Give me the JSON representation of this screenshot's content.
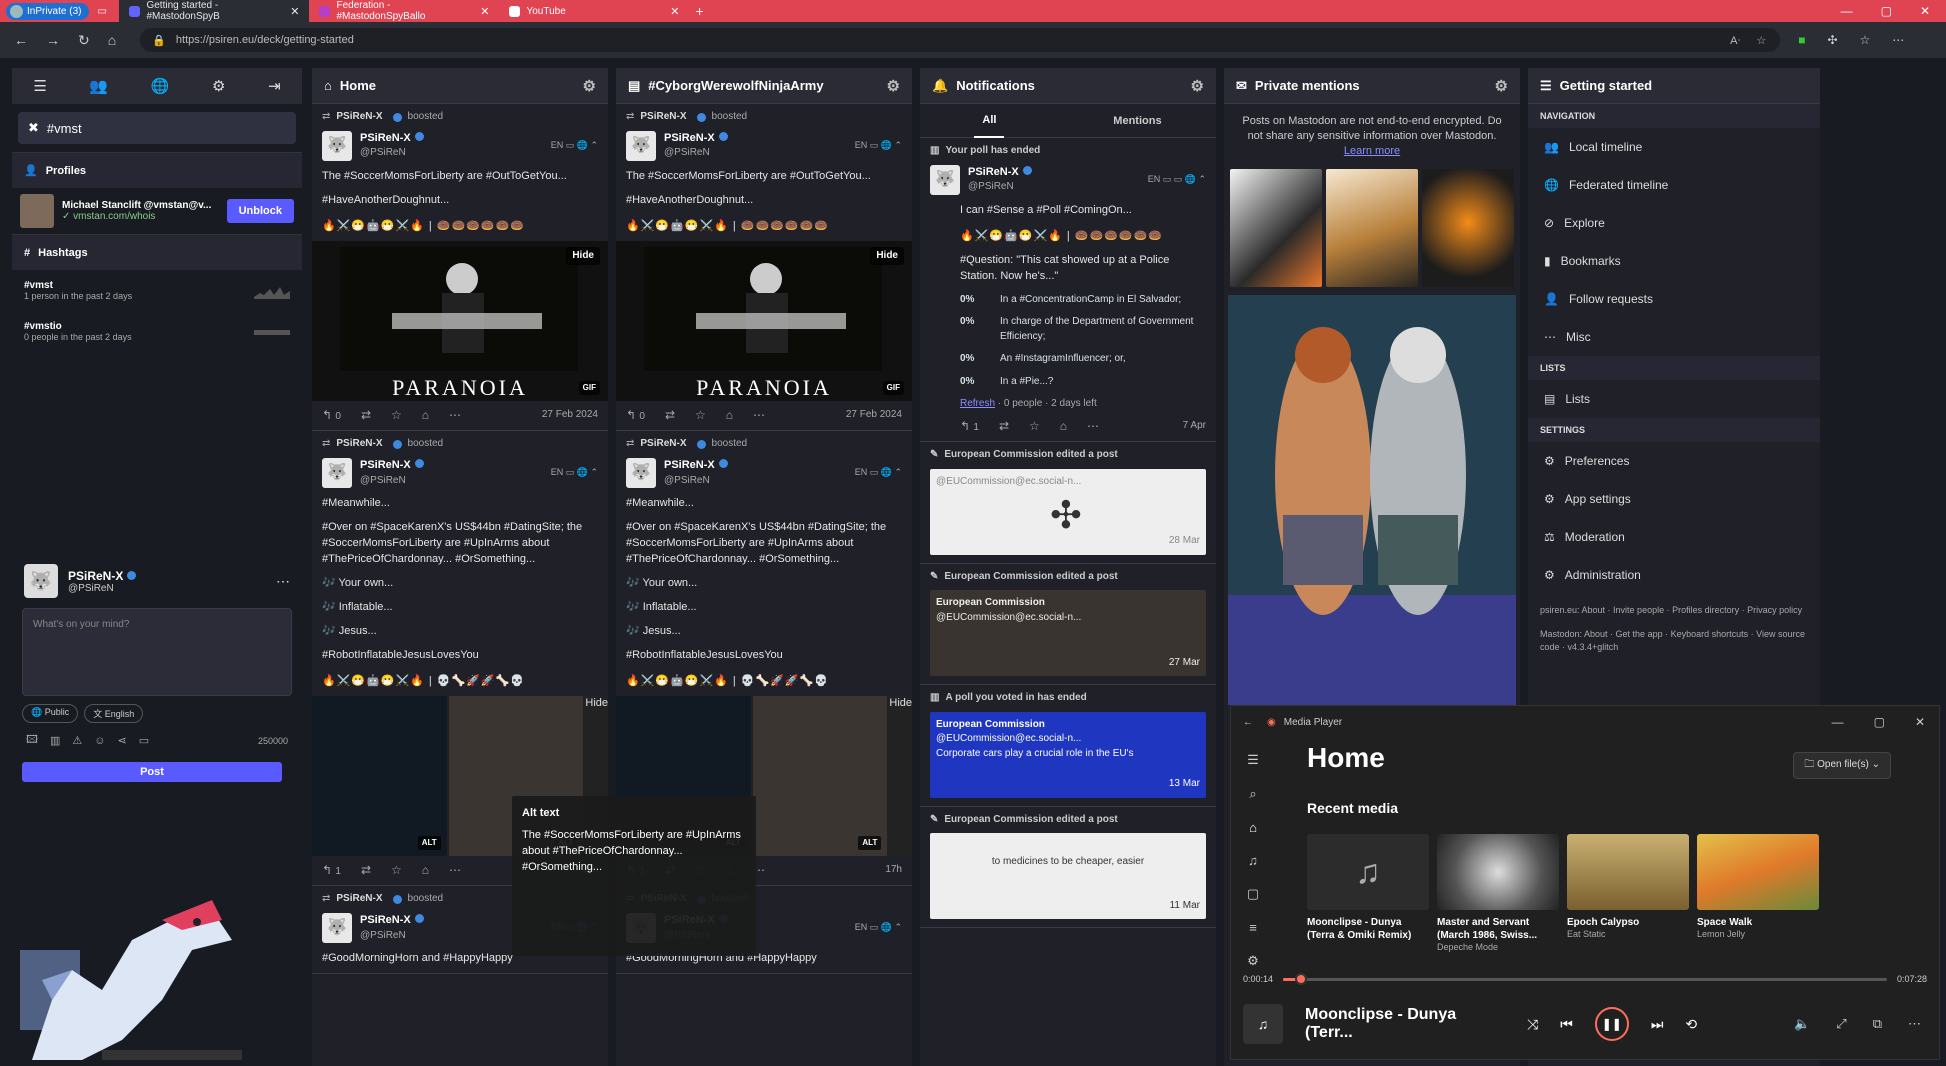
{
  "browser": {
    "private_label": "InPrivate (3)",
    "tabs": [
      {
        "title": "Getting started - #MastodonSpyB",
        "active": true
      },
      {
        "title": "Federation - #MastodonSpyBallo"
      },
      {
        "title": "YouTube"
      }
    ],
    "url": "https://psiren.eu/deck/getting-started"
  },
  "nav_icons": [
    "menu-icon",
    "people-icon",
    "globe-icon",
    "settings-icon",
    "logout-icon"
  ],
  "search": {
    "query": "#vmst"
  },
  "profiles": {
    "header": "Profiles",
    "user_name": "Michael Stanclift @vmstan@v...",
    "user_url": "vmstan.com/whois",
    "unblock": "Unblock"
  },
  "hashtags": {
    "header": "Hashtags",
    "items": [
      {
        "tag": "#vmst",
        "stat": "1 person in the past 2 days"
      },
      {
        "tag": "#vmstio",
        "stat": "0 people in the past 2 days"
      }
    ]
  },
  "me": {
    "name": "PSiReN-X",
    "handle": "@PSiReN"
  },
  "compose": {
    "placeholder": "What's on your mind?",
    "visibility": "Public",
    "language": "English",
    "counter": "250000",
    "post": "Post"
  },
  "columns": {
    "home": "Home",
    "tag": "#CyborgWerewolfNinjaArmy",
    "notifications": "Notifications",
    "private": "Private mentions",
    "getting_started": "Getting started"
  },
  "post": {
    "boosted": "boosted",
    "name": "PSiReN-X",
    "handle": "@PSiReN",
    "lang": "EN",
    "p1_text": "The #SoccerMomsForLiberty are #OutToGetYou...",
    "p1_tag2": "#HaveAnotherDoughnut...",
    "p1_emoji": "🔥⚔️😷🤖😷⚔️🔥 | 🍩🍩🍩🍩🍩🍩",
    "hide": "Hide",
    "gif": "GIF",
    "paranoia": "PARANOIA",
    "p1_replies": "0",
    "p1_time": "27 Feb 2024",
    "p2_l1": "#Meanwhile...",
    "p2_l2": "#Over on #SpaceKarenX's US$44bn #DatingSite; the #SoccerMomsForLiberty are #UpInArms about #ThePriceOfChardonnay... #OrSomething...",
    "p2_l3": "🎶 Your own...",
    "p2_l4": "🎶 Inflatable...",
    "p2_l5": "🎶 Jesus...",
    "p2_l6": "#RobotInflatableJesusLovesYou",
    "p2_emoji": "🔥⚔️😷🤖😷⚔️🔥 | 💀🦴🚀🚀🦴💀",
    "alt": "ALT",
    "p2_replies": "1",
    "p2_time": "17h",
    "p3_text": "#GoodMorningHorn and #HappyHappy"
  },
  "tooltip": {
    "title": "Alt text",
    "body": "The #SoccerMomsForLiberty are #UpInArms about #ThePriceOfChardonnay... #OrSomething..."
  },
  "notifications": {
    "tab_all": "All",
    "tab_mentions": "Mentions",
    "poll_ended": "Your poll has ended",
    "poll_text": "I can #Sense a #Poll #ComingOn...",
    "poll_q": "#Question: \"This cat showed up at a Police Station. Now he's...\"",
    "options": [
      {
        "pct": "0%",
        "label": "In a #ConcentrationCamp in El Salvador;"
      },
      {
        "pct": "0%",
        "label": "In charge of the Department of Government Efficiency;"
      },
      {
        "pct": "0%",
        "label": "An #InstagramInfluencer; or,"
      },
      {
        "pct": "0%",
        "label": "In a #Pie...?"
      }
    ],
    "refresh": "Refresh",
    "poll_meta": "· 0 people · 2 days left",
    "poll_time": "7 Apr",
    "ec_edited": "European Commission edited a post",
    "ec_name": "European Commission",
    "ec_handle": "@EUCommission@ec.social-n...",
    "ec_t1": "28 Mar",
    "ec_t2": "27 Mar",
    "voted": "A poll you voted in has ended",
    "ec_text3": "Corporate cars play a crucial role in the EU's",
    "ec_t3": "13 Mar",
    "ec_text4": "to medicines to be cheaper, easier",
    "ec_t4": "11 Mar"
  },
  "private_mentions": {
    "note": "Posts on Mastodon are not end-to-end encrypted. Do not share any sensitive information over Mastodon.",
    "learn": "Learn more"
  },
  "getting_started": {
    "nav_header": "NAVIGATION",
    "nav": [
      "Local timeline",
      "Federated timeline",
      "Explore",
      "Bookmarks",
      "Follow requests",
      "Misc"
    ],
    "lists_header": "LISTS",
    "lists": [
      "Lists"
    ],
    "settings_header": "SETTINGS",
    "settings": [
      "Preferences",
      "App settings",
      "Moderation",
      "Administration"
    ],
    "footer1": "psiren.eu: About · Invite people · Profiles directory · Privacy policy",
    "footer2": "Mastodon: About · Get the app · Keyboard shortcuts · View source code · v4.3.4+glitch"
  },
  "media_player": {
    "title": "Media Player",
    "home": "Home",
    "open": "Open file(s)",
    "recent": "Recent media",
    "items": [
      {
        "title": "Moonclipse - Dunya (Terra & Omiki Remix)",
        "artist": ""
      },
      {
        "title": "Master and Servant (March 1986, Swiss...",
        "artist": "Depeche Mode"
      },
      {
        "title": "Epoch Calypso",
        "artist": "Eat Static"
      },
      {
        "title": "Space Walk",
        "artist": "Lemon Jelly"
      }
    ],
    "elapsed": "0:00:14",
    "total": "0:07:28",
    "progress": 0.03,
    "now_playing": "Moonclipse - Dunya (Terr..."
  }
}
